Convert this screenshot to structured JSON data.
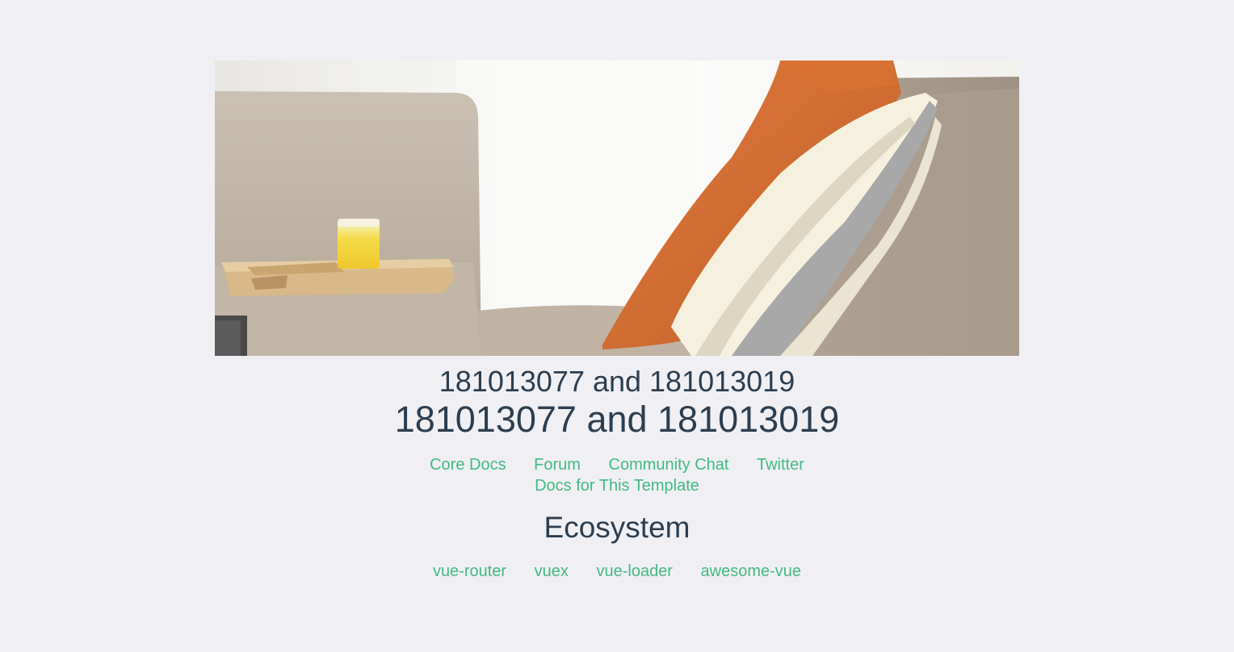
{
  "hero": {
    "image_icon": "sofa-with-pillows-photo"
  },
  "heading": {
    "small": "181013077 and 181013019",
    "large": "181013077 and 181013019"
  },
  "essential_links": [
    {
      "label": "Core Docs"
    },
    {
      "label": "Forum"
    },
    {
      "label": "Community Chat"
    },
    {
      "label": "Twitter"
    },
    {
      "label": "Docs for This Template"
    }
  ],
  "ecosystem": {
    "title": "Ecosystem",
    "links": [
      {
        "label": "vue-router"
      },
      {
        "label": "vuex"
      },
      {
        "label": "vue-loader"
      },
      {
        "label": "awesome-vue"
      }
    ]
  },
  "colors": {
    "background": "#f0f0f4",
    "heading": "#2c3e50",
    "link": "#42b983"
  }
}
